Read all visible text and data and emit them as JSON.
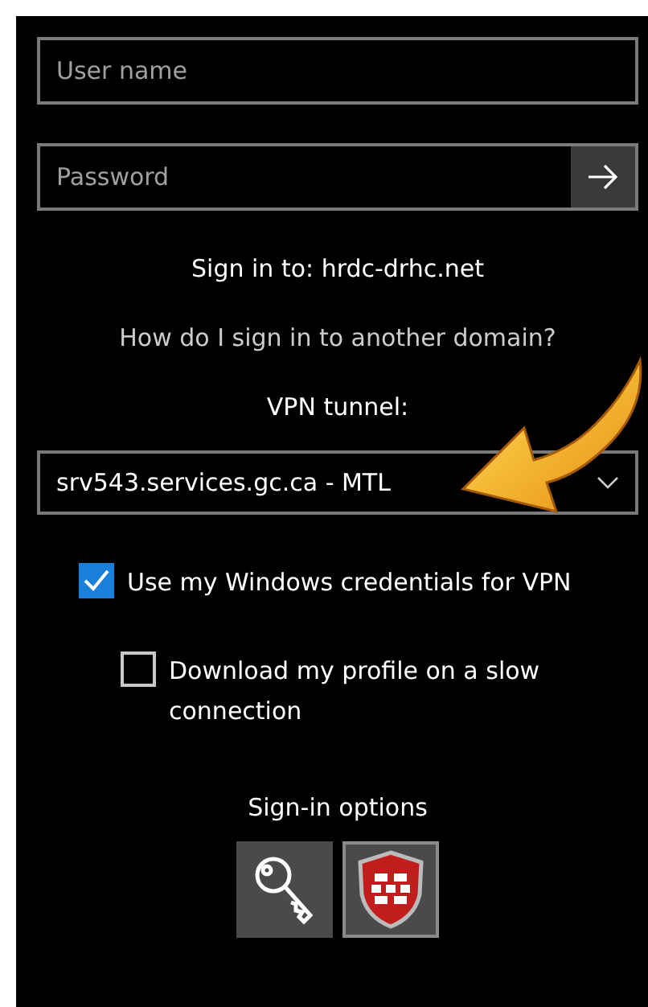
{
  "username": {
    "placeholder": "User name"
  },
  "password": {
    "placeholder": "Password"
  },
  "sign_in_to": "Sign in to: hrdc-drhc.net",
  "other_domain_link": "How do I sign in to another domain?",
  "vpn_label": "VPN tunnel:",
  "vpn_dropdown": {
    "value": "srv543.services.gc.ca - MTL"
  },
  "checkboxes": [
    {
      "label": "Use my Windows credentials for VPN",
      "checked": true
    },
    {
      "label": "Download my profile on a slow connection",
      "checked": false
    }
  ],
  "sign_in_options": {
    "title": "Sign-in options",
    "items": [
      {
        "kind": "key",
        "selected": false
      },
      {
        "kind": "shield",
        "selected": true
      }
    ]
  }
}
